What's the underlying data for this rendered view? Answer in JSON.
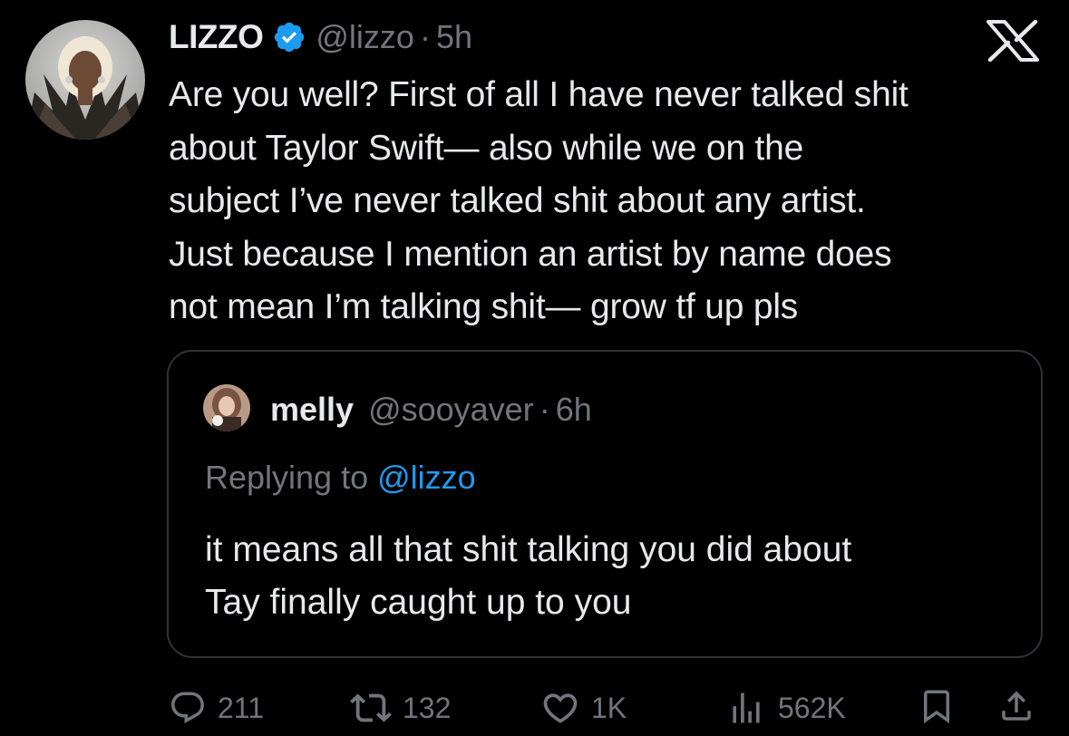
{
  "tweet": {
    "author": {
      "name": "LIZZO",
      "handle": "@lizzo",
      "verified": true,
      "avatar_icon": "profile-avatar"
    },
    "separator": "·",
    "time": "5h",
    "platform_icon": "x-logo-icon",
    "text": "Are you well? First of all I have never talked shit\nabout Taylor Swift— also while we on the\nsubject I’ve never talked shit about any artist.\nJust because I mention an artist by name does\nnot mean I’m talking shit— grow tf up pls"
  },
  "quoted_tweet": {
    "author": {
      "name": "melly",
      "handle": "@sooyaver",
      "avatar_icon": "profile-avatar"
    },
    "separator": "·",
    "time": "6h",
    "replying_to_label": "Replying to ",
    "replying_to_handle": "@lizzo",
    "text": "it means all that shit talking you did about\nTay finally caught up to you"
  },
  "actions": {
    "replies": "211",
    "reposts": "132",
    "likes": "1K",
    "views": "562K"
  },
  "colors": {
    "background": "#000000",
    "text_primary": "#e7e9ea",
    "text_secondary": "#71767b",
    "accent": "#1d9bf0",
    "border": "#2f3336"
  }
}
